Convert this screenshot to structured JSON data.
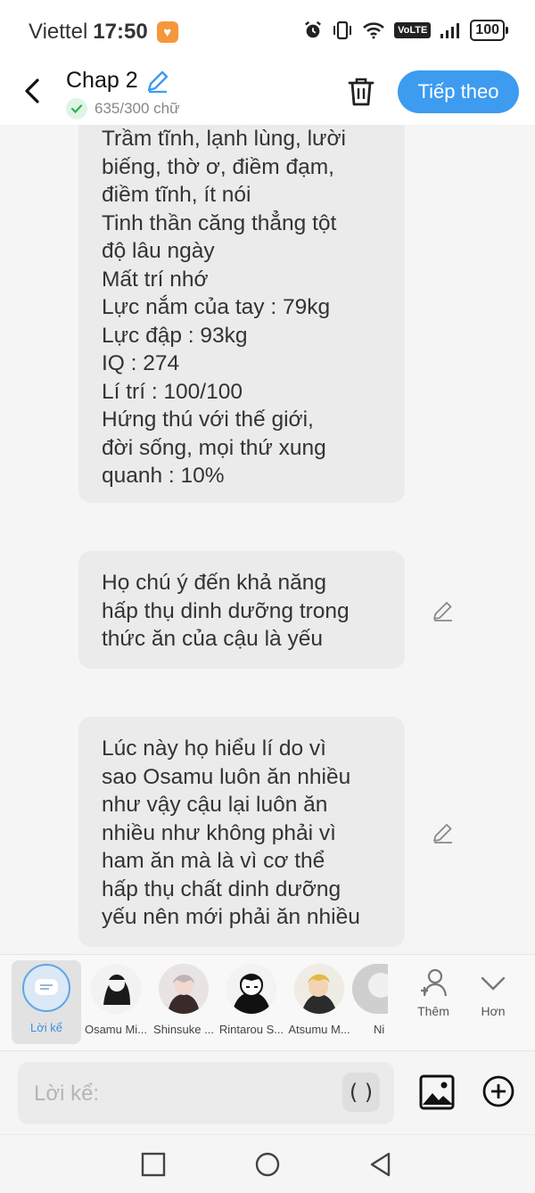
{
  "status_bar": {
    "carrier": "Viettel",
    "time": "17:50",
    "volte": "VoLTE",
    "battery": "100"
  },
  "header": {
    "title": "Chap 2",
    "char_count": "635/300 chữ",
    "next_label": "Tiếp theo"
  },
  "messages": [
    {
      "lines": [
        "Trầm tĩnh, lạnh lùng, lười",
        "biếng, thờ ơ, điềm đạm,",
        "điềm tĩnh, ít nói",
        "Tinh thần căng thẳng tột",
        "độ lâu ngày",
        "Mất trí nhớ",
        "Lực nắm của tay : 79kg",
        "Lực đập : 93kg",
        "IQ : 274",
        "Lí trí : 100/100",
        "Hứng thú với thế giới,",
        "đời sống, mọi thứ xung",
        "quanh : 10%"
      ]
    },
    {
      "lines": [
        "Họ chú ý đến khả năng",
        "hấp thụ dinh dưỡng trong",
        "thức ăn của cậu là yếu"
      ]
    },
    {
      "lines": [
        "Lúc này họ hiểu lí do vì",
        "sao Osamu luôn ăn nhiều",
        "như vậy cậu lại luôn ăn",
        "nhiều như không phải vì",
        "ham ăn mà là vì cơ thể",
        "hấp thụ chất dinh dưỡng",
        "yếu nên mới phải ăn nhiều"
      ]
    }
  ],
  "characters": [
    {
      "name": "Lời kể"
    },
    {
      "name": "Osamu Mi..."
    },
    {
      "name": "Shinsuke ..."
    },
    {
      "name": "Rintarou S..."
    },
    {
      "name": "Atsumu M..."
    },
    {
      "name": "Ni"
    }
  ],
  "tools": {
    "add_label": "Thêm",
    "more_label": "Hơn"
  },
  "input": {
    "placeholder": "Lời kể:",
    "paren": "( )"
  }
}
